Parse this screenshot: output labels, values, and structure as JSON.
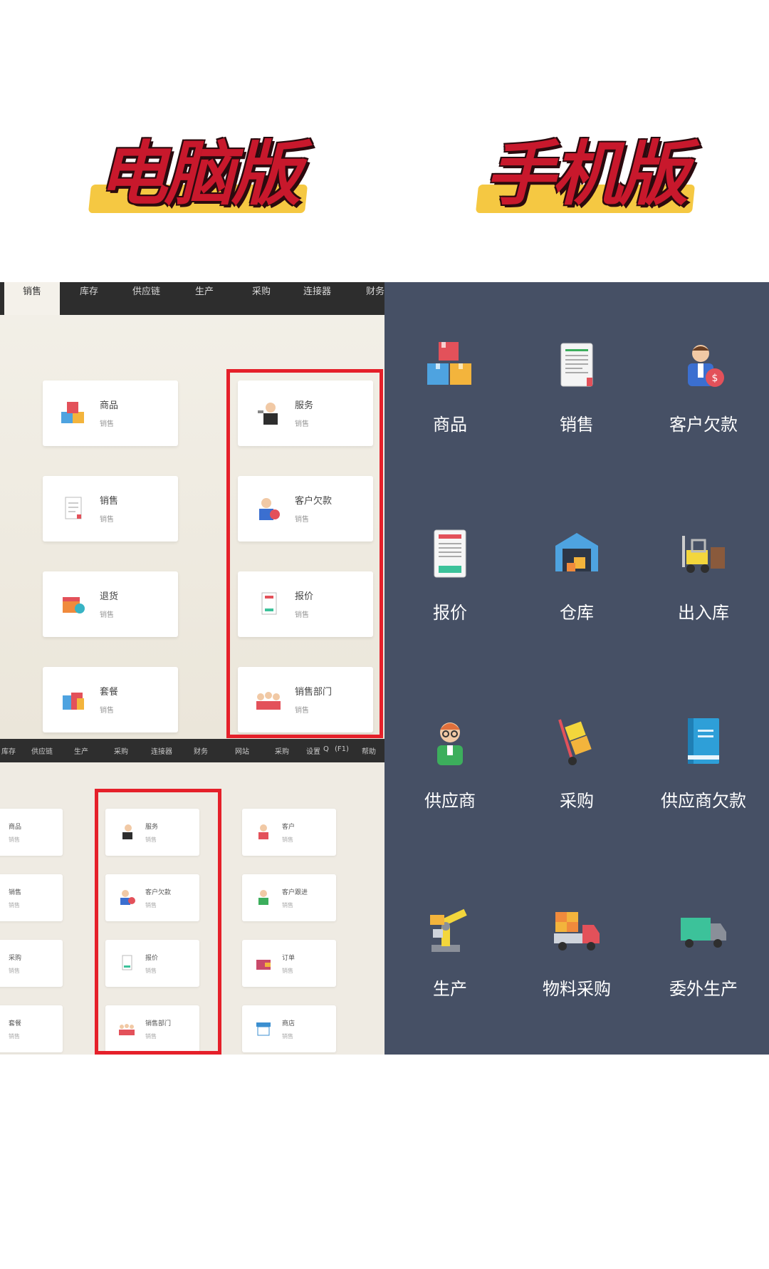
{
  "headlines": {
    "pc": "电脑版",
    "mobile": "手机版"
  },
  "desktop": {
    "menu_tabs": [
      "销售",
      "库存",
      "供应链",
      "生产",
      "采购",
      "连接器",
      "财务"
    ],
    "left_cards": [
      {
        "title": "商品",
        "sub": "销售",
        "icon": "boxes-icon"
      },
      {
        "title": "销售",
        "sub": "销售",
        "icon": "document-icon"
      },
      {
        "title": "退货",
        "sub": "销售",
        "icon": "return-box-icon"
      },
      {
        "title": "套餐",
        "sub": "销售",
        "icon": "shopping-bags-icon"
      }
    ],
    "right_cards": [
      {
        "title": "服务",
        "sub": "销售",
        "icon": "waiter-icon"
      },
      {
        "title": "客户欠款",
        "sub": "销售",
        "icon": "customer-debt-icon"
      },
      {
        "title": "报价",
        "sub": "销售",
        "icon": "quote-icon"
      },
      {
        "title": "销售部门",
        "sub": "销售",
        "icon": "team-icon"
      }
    ],
    "bottom_menu": [
      "库存",
      "供应链",
      "生产",
      "采购",
      "连接器",
      "财务",
      "网站",
      "采购",
      "设置",
      "Q",
      "(F1)",
      "帮助"
    ],
    "bottom_col1": [
      {
        "title": "商品",
        "sub": "销售"
      },
      {
        "title": "销售",
        "sub": "销售"
      },
      {
        "title": "采购",
        "sub": "销售"
      },
      {
        "title": "套餐",
        "sub": "销售"
      }
    ],
    "bottom_col2": [
      {
        "title": "服务",
        "sub": "销售"
      },
      {
        "title": "客户欠款",
        "sub": "销售"
      },
      {
        "title": "报价",
        "sub": "销售"
      },
      {
        "title": "销售部门",
        "sub": "销售"
      }
    ],
    "bottom_col3": [
      {
        "title": "客户",
        "sub": "销售"
      },
      {
        "title": "客户跟进",
        "sub": "销售"
      },
      {
        "title": "订单",
        "sub": "销售"
      },
      {
        "title": "商店",
        "sub": "销售"
      }
    ]
  },
  "mobile": {
    "items": [
      {
        "label": "商品",
        "icon": "boxes-icon"
      },
      {
        "label": "销售",
        "icon": "document-icon"
      },
      {
        "label": "客户欠款",
        "icon": "customer-debt-icon"
      },
      {
        "label": "报价",
        "icon": "quote-icon"
      },
      {
        "label": "仓库",
        "icon": "warehouse-icon"
      },
      {
        "label": "出入库",
        "icon": "forklift-icon"
      },
      {
        "label": "供应商",
        "icon": "supplier-person-icon"
      },
      {
        "label": "采购",
        "icon": "hand-truck-icon"
      },
      {
        "label": "供应商欠款",
        "icon": "ledger-book-icon"
      },
      {
        "label": "生产",
        "icon": "robot-arm-icon"
      },
      {
        "label": "物料采购",
        "icon": "delivery-truck-icon"
      },
      {
        "label": "委外生产",
        "icon": "green-truck-icon"
      }
    ]
  },
  "colors": {
    "highlight_box": "#e5202a",
    "mobile_bg": "#465065",
    "headline_red": "#c8182c",
    "headline_yellow": "#f5c842"
  }
}
